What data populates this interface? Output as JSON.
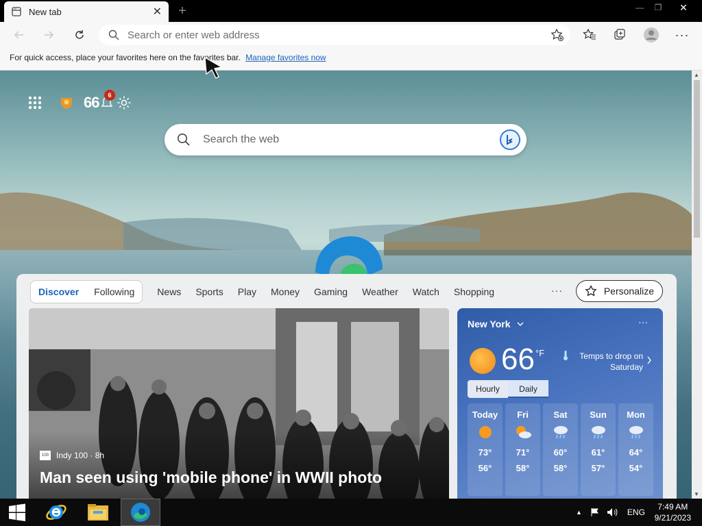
{
  "browser": {
    "tab_title": "New tab",
    "tab_close": "✕",
    "new_tab": "+",
    "win_min": "—",
    "win_max": "❐",
    "win_close": "✕",
    "address_placeholder": "Search or enter web address"
  },
  "favbar": {
    "text": "For quick access, place your favorites here on the favorites bar.",
    "link": "Manage favorites now"
  },
  "ntp": {
    "rewards_points": "66",
    "notification_count": "6",
    "search_placeholder": "Search the web"
  },
  "feed": {
    "tabs": [
      "Discover",
      "Following"
    ],
    "nav": [
      "News",
      "Sports",
      "Play",
      "Money",
      "Gaming",
      "Weather",
      "Watch",
      "Shopping"
    ],
    "more": "···",
    "personalize": "Personalize"
  },
  "hero": {
    "source": "Indy 100 · 8h",
    "source_logo": "100",
    "headline": "Man seen using 'mobile phone' in WWII photo"
  },
  "weather": {
    "city": "New York",
    "temp": "66",
    "unit": "°F",
    "message": "Temps to drop on Saturday",
    "more": "···",
    "tab_hourly": "Hourly",
    "tab_daily": "Daily",
    "days": [
      {
        "name": "Today",
        "hi": "73°",
        "lo": "56°",
        "icon": "sunny-icon"
      },
      {
        "name": "Fri",
        "hi": "71°",
        "lo": "58°",
        "icon": "partly-cloudy-icon"
      },
      {
        "name": "Sat",
        "hi": "60°",
        "lo": "58°",
        "icon": "rain-icon"
      },
      {
        "name": "Sun",
        "hi": "61°",
        "lo": "57°",
        "icon": "rain-icon"
      },
      {
        "name": "Mon",
        "hi": "64°",
        "lo": "54°",
        "icon": "rain-icon"
      }
    ]
  },
  "taskbar": {
    "language": "ENG",
    "time": "7:49 AM",
    "date": "9/21/2023"
  }
}
